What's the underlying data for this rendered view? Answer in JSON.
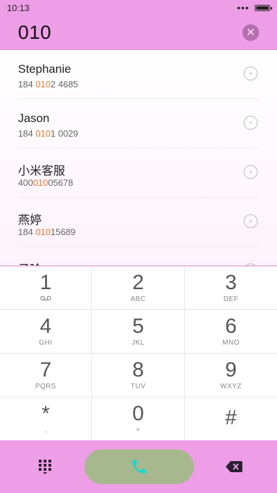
{
  "status_bar": {
    "time": "10:13",
    "overflow_dots": "•••"
  },
  "dialer": {
    "input_value": "010"
  },
  "results": [
    {
      "name": "Stephanie",
      "number_prefix": "184 ",
      "number_match": "010",
      "number_suffix": "2 4685"
    },
    {
      "name": "Jason",
      "number_prefix": "184 ",
      "number_match": "010",
      "number_suffix": "1 0029"
    },
    {
      "name": "小米客服",
      "number_prefix": "400",
      "number_match": "010",
      "number_suffix": "05678"
    },
    {
      "name": "燕婷",
      "number_prefix": "184 ",
      "number_match": "010",
      "number_suffix": "15689"
    },
    {
      "name": "子玲",
      "number_prefix": "",
      "number_match": "",
      "number_suffix": ""
    }
  ],
  "keypad": {
    "keys": [
      {
        "digit": "1",
        "letters": ""
      },
      {
        "digit": "2",
        "letters": "ABC"
      },
      {
        "digit": "3",
        "letters": "DEF"
      },
      {
        "digit": "4",
        "letters": "GHI"
      },
      {
        "digit": "5",
        "letters": "JKL"
      },
      {
        "digit": "6",
        "letters": "MNO"
      },
      {
        "digit": "7",
        "letters": "PQRS"
      },
      {
        "digit": "8",
        "letters": "TUV"
      },
      {
        "digit": "9",
        "letters": "WXYZ"
      },
      {
        "digit": "*",
        "letters": ","
      },
      {
        "digit": "0",
        "letters": "+"
      },
      {
        "digit": "#",
        "letters": ""
      }
    ]
  },
  "colors": {
    "accent": "#ee9ee6",
    "match": "#f07830",
    "call_button": "#a7b88e",
    "call_icon": "#18d6d2"
  },
  "icons": {
    "voicemail": "voicemail-icon",
    "keypad_toggle": "dialpad-icon",
    "call": "phone-icon",
    "backspace": "backspace-icon",
    "clear": "close-icon",
    "chevron": "chevron-right-icon"
  }
}
